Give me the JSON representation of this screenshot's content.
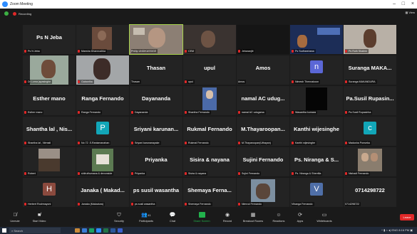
{
  "window": {
    "title": "Zoom Meeting",
    "controls": [
      "–",
      "□",
      "×"
    ]
  },
  "status": {
    "recording": "Recording",
    "view": "View"
  },
  "participants": [
    {
      "big": "Ps N Jeba",
      "name": "Ps N Jeba"
    },
    {
      "big": "",
      "name": "Mansha Dhannushka"
    },
    {
      "big": "",
      "name": "Phillip UNDIKASSIGE"
    },
    {
      "big": "",
      "name": "CEM"
    },
    {
      "big": "",
      "name": "Jebaranjiti"
    },
    {
      "big": "",
      "name": "Ps Sudharshana"
    },
    {
      "big": "",
      "name": "Ps Ruth Shalem"
    },
    {
      "big": "",
      "name": "Dr Lorna jayasinghe"
    },
    {
      "big": "",
      "name": "Gabantha"
    },
    {
      "big": "Thasan",
      "name": "Thasan"
    },
    {
      "big": "upul",
      "name": "upul"
    },
    {
      "big": "Amos",
      "name": "Amos"
    },
    {
      "big": "",
      "name": "Nimesh Thennakoon",
      "letter": "n"
    },
    {
      "big": "Suranga MAKA...",
      "name": "Suranga MAKANDURA"
    },
    {
      "big": "Esther mano",
      "name": "Esther mano"
    },
    {
      "big": "Ranga Fernando",
      "name": "Ranga Fernando"
    },
    {
      "big": "Dayananda",
      "name": "Dayananda"
    },
    {
      "big": "",
      "name": "Shantha Fernando"
    },
    {
      "big": "namal AC udug...",
      "name": "namal AC udugama"
    },
    {
      "big": "",
      "name": "Wasantha kumara"
    },
    {
      "big": "Pa.Susil Rupasin...",
      "name": "Pa.Susil Rupasinha"
    },
    {
      "big": "Shantha lal , Nis...",
      "name": "Shantha lal , Nirmali"
    },
    {
      "big": "",
      "name": "No 72 .S.Raniamanahan",
      "letter": "P"
    },
    {
      "big": "Sriyani karunan...",
      "name": "Sriyani karunanayake"
    },
    {
      "big": "Rukmal Fernando",
      "name": "Rukmal Fernando"
    },
    {
      "big": "M.Thayaroopan...",
      "name": "M.Thayaroopan(Uthayan)"
    },
    {
      "big": "Kanthi wijesinghe",
      "name": "Kanthi wijesinghe"
    },
    {
      "big": "",
      "name": "Madusha Ponseka",
      "letter": "c"
    },
    {
      "big": "",
      "name": "Robert"
    },
    {
      "big": "",
      "name": "shilruthumana & devonside"
    },
    {
      "big": "Priyanka",
      "name": "Priyanka"
    },
    {
      "big": "Sisira & nayana",
      "name": "Sisira & nayana"
    },
    {
      "big": "Sujini Fernando",
      "name": "Sujini Fernando"
    },
    {
      "big": "Ps. Niranga & S...",
      "name": "Ps. Niranga & Sherrilla"
    },
    {
      "big": "",
      "name": "Nishadi Fernando"
    },
    {
      "big": "",
      "name": "Herbert Rodrmayoni",
      "letter": "H"
    },
    {
      "big": "Janaka ( Makad...",
      "name": "Janaka (Makadura)"
    },
    {
      "big": "ps susil wasantha",
      "name": "ps susil wasantha"
    },
    {
      "big": "Shemaya Ferna...",
      "name": "Shemaya Fernando"
    },
    {
      "big": "",
      "name": "Nimrod Fernando"
    },
    {
      "big": "",
      "name": "Vihanga Fernando",
      "letter": "V"
    },
    {
      "big": "0714298722",
      "name": "0714298722"
    }
  ],
  "toolbar": {
    "unmute": "Unmute",
    "start_video": "Start Video",
    "security": "Security",
    "participants": "Participants",
    "participants_count": "41",
    "chat": "Chat",
    "share": "Share Screen",
    "record": "Record",
    "breakout": "Breakout Rooms",
    "reactions": "Reactions",
    "apps": "Apps",
    "whiteboards": "Whiteboards",
    "leave": "Leave"
  },
  "taskbar": {
    "search": "Search",
    "lang": "ENG",
    "time": "8:16 PM"
  },
  "colors": {
    "accent": "#2d8cff",
    "share": "#22b14c",
    "leave": "#e02828",
    "active": "#a6d24a"
  }
}
